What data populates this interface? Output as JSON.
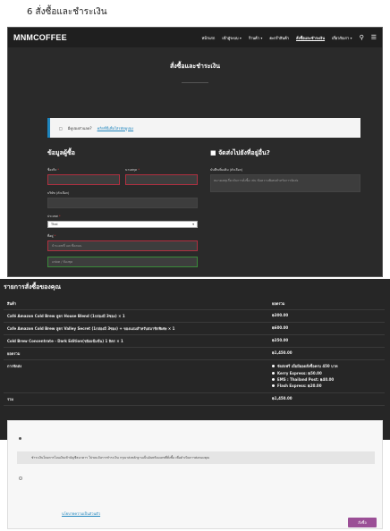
{
  "caption": "6 สั่งซื้อและชำระเงิน",
  "site": {
    "logo": "MNMCOFFEE",
    "nav": [
      {
        "label": "หน้าแรก"
      },
      {
        "label": "เข้าสู่ระบบ ▾"
      },
      {
        "label": "ร้านค้า ▾"
      },
      {
        "label": "ตะกร้าสินค้า"
      },
      {
        "label": "สั่งซื้อและชำระเงิน"
      },
      {
        "label": "เกี่ยวกับเรา ▾"
      }
    ],
    "page_title": "สั่งซื้อและชำระเงิน",
    "notice_text": "มีคูปองส่วนลด?",
    "notice_link": "คลิกที่นี่เพื่อใส่รหัสคูปอง"
  },
  "billing": {
    "heading": "ข้อมูลผู้ซื้อ",
    "first_name_label": "ชื่อจริง",
    "last_name_label": "นามสกุล",
    "company_label": "บริษัท (ตัวเลือก)",
    "country_label": "ประเทศ",
    "country_value": "Thai",
    "address_label": "ที่อยู่",
    "address_placeholder": "บ้านเลขที่ และชื่อถนน",
    "address2_placeholder": "แฟลต / ห้องชุด"
  },
  "shipping_alt": {
    "heading": "จัดส่งไปยังที่อยู่อื่น?",
    "notes_label": "บันทึกเพิ่มเติม (ตัวเลือก)",
    "notes_placeholder": "หมายเหตุเกี่ยวกับการสั่งซื้อ เช่น ข้อความพิเศษสำหรับการจัดส่ง"
  },
  "order": {
    "heading": "รายการสั่งซื้อของคุณ",
    "col_product": "สินค้า",
    "col_subtotal": "ยอดรวม",
    "items": [
      {
        "name": "Café Amazon Cold Brew สูตร House Blend (1กล่องมี 3ซอง) × 1",
        "price": "฿300.00"
      },
      {
        "name": "Cafe Amazon Cold Brew สูตร Valley Secret (1กล่องมี 3ซอง) + ของแถมสำหรับสมาชิกพิเศษ × 1",
        "price": "฿600.00"
      },
      {
        "name": "Cold Brew Concentrate - Dark Edition(ชนิดเข้มข้น) 1 ลิตร × 1",
        "price": "฿350.00"
      }
    ],
    "subtotal_label": "ยอดรวม",
    "subtotal_value": "฿1,450.00",
    "shipping_label": "การจัดส่ง",
    "shipping_options": [
      {
        "label": "จัดส่งฟรี เมื่อมียอดสั่งซื้อครบ 450 บาท"
      },
      {
        "label": "Kerry Express: ฿50.00"
      },
      {
        "label": "EMS : Thailand Post: ฿40.00"
      },
      {
        "label": "Flash Express: ฿20.00"
      }
    ],
    "total_label": "รวม",
    "total_value": "฿1,450.00"
  },
  "payment": {
    "box_text": "ชำระเงินโดยการโอนเงินเข้าบัญชีธนาคาร โปรดแจ้งการชำระเงิน กรุณาส่งหลักฐานเป็นอันพร้อมเลขที่สั่งซื้อ เพื่อดำเนินการต่อของคุณ",
    "privacy_link": "นโยบายความเป็นส่วนตัว",
    "place_order_label": "สั่งซื้อ"
  }
}
